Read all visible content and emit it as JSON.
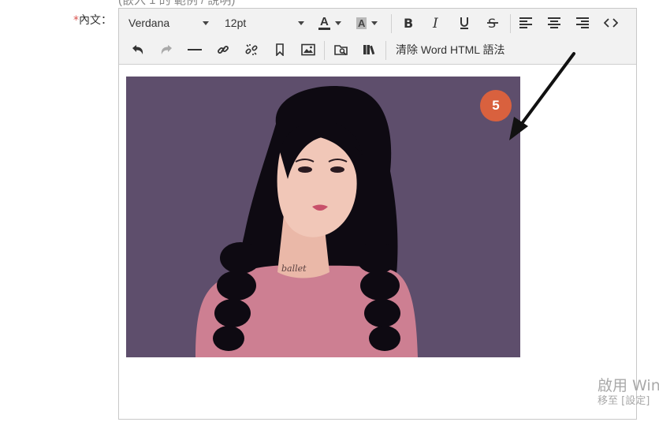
{
  "top_partial_text": "(嵌入 1 的 範例 / 說明)",
  "field_label": {
    "required_mark": "*",
    "text": "內文："
  },
  "toolbar": {
    "font_family": "Verdana",
    "font_size": "12pt",
    "text_color_label": "A",
    "bg_color_label": "A",
    "clean_word_label": "清除 Word HTML 語法",
    "icons": [
      "bold-icon",
      "italic-icon",
      "underline-icon",
      "strikethrough-icon",
      "align-left-icon",
      "align-center-icon",
      "align-right-icon",
      "source-code-icon",
      "undo-icon",
      "redo-icon",
      "horizontal-rule-icon",
      "link-icon",
      "unlink-icon",
      "bookmark-icon",
      "image-icon",
      "folder-browse-icon",
      "library-icon"
    ]
  },
  "image": {
    "tattoo_text": "ballet"
  },
  "annotation": {
    "badge": "5",
    "color": "#d9613e"
  },
  "watermark": {
    "line1": "啟用 Win",
    "line2": "移至 [設定]"
  }
}
